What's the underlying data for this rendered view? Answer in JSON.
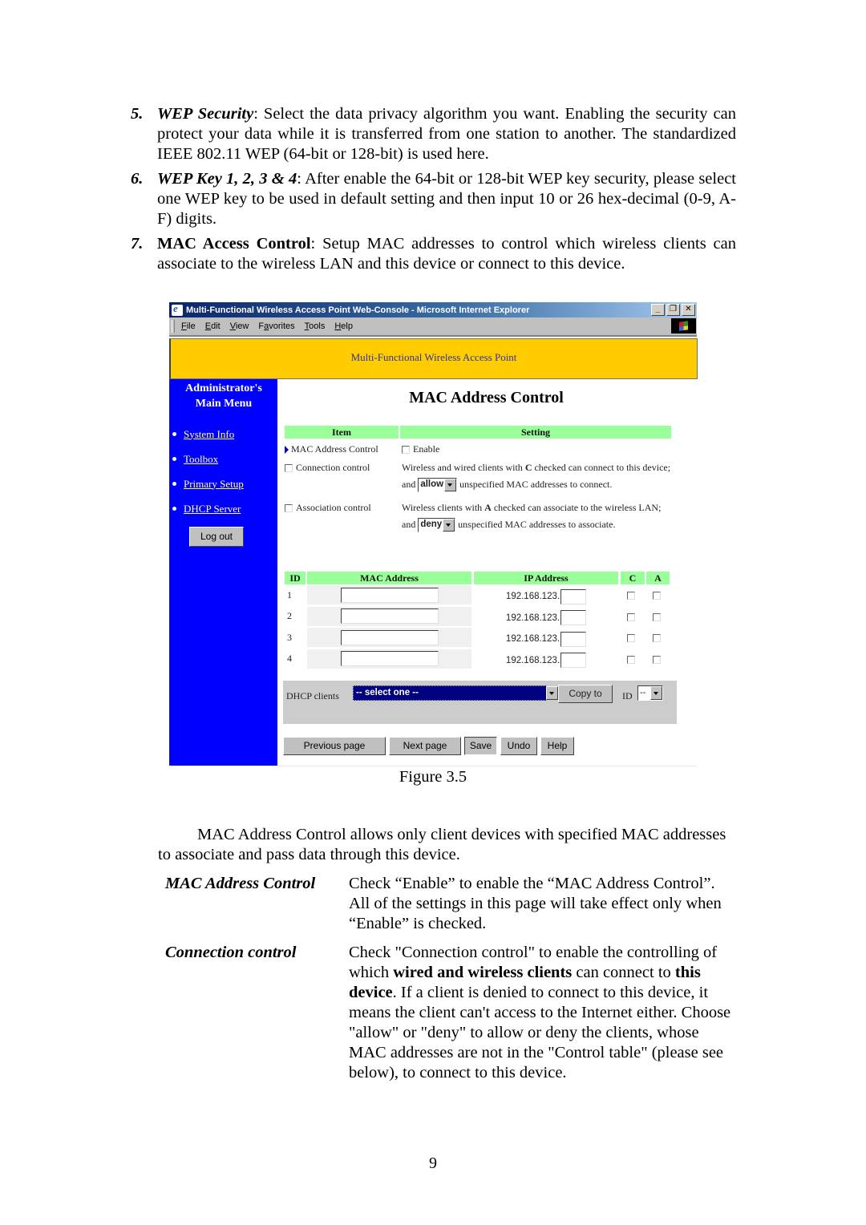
{
  "document": {
    "list_items": [
      {
        "number": "5.",
        "term": "WEP Security",
        "text": ": Select the data privacy algorithm you want. Enabling the security can protect your data while it is transferred from one station to another. The standardized IEEE 802.11 WEP (64-bit or 128-bit) is used here."
      },
      {
        "number": "6.",
        "term": "WEP Key 1, 2, 3 & 4",
        "text": ": After enable the 64-bit or 128-bit WEP key security, please select one WEP key to be used in default setting and then input 10 or 26 hex-decimal (0-9, A-F) digits."
      },
      {
        "number": "7.",
        "term": "MAC Access Control",
        "text": ": Setup MAC addresses to control which wireless clients can associate to the wireless LAN and this device or connect to this device."
      }
    ],
    "figure_caption": "Figure 3.5",
    "intro_paragraph": "MAC Address Control allows only client devices with specified MAC addresses to associate and pass data through this device.",
    "definitions": [
      {
        "term": "MAC Address Control",
        "description": "Check “Enable” to enable the “MAC Address Control”. All of the settings in this page will take effect only when “Enable” is checked."
      },
      {
        "term": "Connection control",
        "description_parts": [
          {
            "text": "Check \"Connection control\" to enable the controlling of which ",
            "bold": false
          },
          {
            "text": "wired and wireless clients",
            "bold": true
          },
          {
            "text": " can connect to ",
            "bold": false
          },
          {
            "text": "this device",
            "bold": true
          },
          {
            "text": ". If a client is denied to connect to this device, it means the client can't access to the Internet either. Choose \"allow\" or \"deny\" to allow or deny the clients, whose MAC addresses are not in the \"Control table\" (please see below), to connect to this device.",
            "bold": false
          }
        ]
      }
    ],
    "page_number": "9"
  },
  "browser": {
    "title": "Multi-Functional Wireless Access Point Web-Console - Microsoft Internet Explorer",
    "window_buttons": [
      "_",
      "❐",
      "✕"
    ],
    "menu": [
      "File",
      "Edit",
      "View",
      "Favorites",
      "Tools",
      "Help"
    ],
    "menu_accelerators": [
      "F",
      "E",
      "V",
      "a",
      "T",
      "H"
    ]
  },
  "web_page": {
    "banner": "Multi-Functional Wireless Access Point",
    "sidebar": {
      "title_line1": "Administrator's",
      "title_line2": "Main Menu",
      "links": [
        "System Info",
        "Toolbox",
        "Primary Setup",
        "DHCP Server"
      ],
      "logout_label": "Log out"
    },
    "page_title": "MAC Address Control",
    "settings": {
      "header_item": "Item",
      "header_setting": "Setting",
      "mac_control_label": "MAC Address Control",
      "enable_label": "Enable",
      "enable_checked": false,
      "connection_label": "Connection control",
      "connection_checked": false,
      "connection_text_1": "Wireless and wired clients with ",
      "connection_text_bold": "C",
      "connection_text_2": " checked can connect to this device; and ",
      "connection_select": "allow",
      "connection_text_3": " unspecified MAC addresses to connect.",
      "association_label": "Association control",
      "association_checked": false,
      "association_text_1": "Wireless clients with ",
      "association_text_bold": "A",
      "association_text_2": " checked can associate to the wireless LAN; and ",
      "association_select": "deny",
      "association_text_3": " unspecified MAC addresses to associate."
    },
    "mac_table": {
      "headers": [
        "ID",
        "MAC Address",
        "IP Address",
        "C",
        "A"
      ],
      "ip_prefix": "192.168.123.",
      "rows": [
        {
          "id": "1",
          "mac": "",
          "ip_suffix": "",
          "c": false,
          "a": false
        },
        {
          "id": "2",
          "mac": "",
          "ip_suffix": "",
          "c": false,
          "a": false
        },
        {
          "id": "3",
          "mac": "",
          "ip_suffix": "",
          "c": false,
          "a": false
        },
        {
          "id": "4",
          "mac": "",
          "ip_suffix": "",
          "c": false,
          "a": false
        }
      ]
    },
    "dhcp": {
      "label": "DHCP clients",
      "select_value": "-- select one --",
      "copy_label": "Copy to",
      "id_label": "ID",
      "id_value": "--"
    },
    "buttons": {
      "previous": "Previous page",
      "next": "Next page",
      "save": "Save",
      "undo": "Undo",
      "help": "Help"
    },
    "colors": {
      "banner": "#ffcc00",
      "sidebar": "#0000ff",
      "table_header": "#99ff99",
      "link": "#ffff99"
    }
  }
}
